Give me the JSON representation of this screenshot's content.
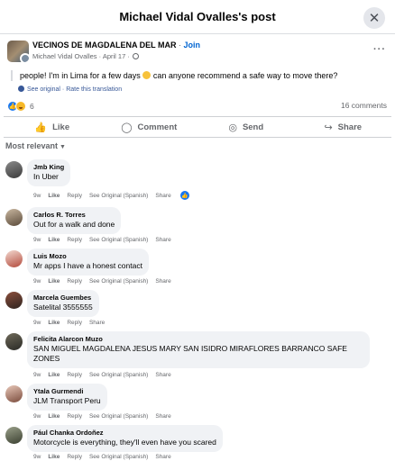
{
  "header": {
    "title": "Michael Vidal Ovalles's post",
    "close_icon": "close-icon"
  },
  "post": {
    "group_name": "VECINOS DE MAGDALENA DEL MAR",
    "separator": "·",
    "join_label": "Join",
    "author_meta": "Michael Vidal Ovalles · April 17 ·",
    "text_before_emoji": "people! I'm in Lima for a few days",
    "text_after_emoji": "can anyone recommend a safe way to move there?",
    "see_original": "See original",
    "rate_translation": "Rate this translation",
    "translate_separator": "·",
    "reaction_count": "6",
    "comments_count": "16 comments"
  },
  "actions": {
    "like": "Like",
    "comment": "Comment",
    "send": "Send",
    "share": "Share"
  },
  "sort_label": "Most relevant",
  "colors": {
    "accent": "#1877f2",
    "bubble": "#f0f2f5",
    "muted": "#65676b",
    "link": "#385898"
  },
  "comments": [
    {
      "name": "Jmb King",
      "text": "In Uber",
      "time": "9w",
      "like": "Like",
      "reply": "Reply",
      "see_original": "See Original (Spanish)",
      "share": "Share",
      "has_reaction": true
    },
    {
      "name": "Carlos R. Torres",
      "text": "Out for a walk and done",
      "time": "9w",
      "like": "Like",
      "reply": "Reply",
      "see_original": "See Original (Spanish)",
      "share": "Share"
    },
    {
      "name": "Luis Mozo",
      "text": "Mr apps I have a honest contact",
      "time": "9w",
      "like": "Like",
      "reply": "Reply",
      "see_original": "See Original (Spanish)",
      "share": "Share"
    },
    {
      "name": "Marcela Guembes",
      "text": "Satelital 3555555",
      "time": "9w",
      "like": "Like",
      "reply": "Reply",
      "share": "Share"
    },
    {
      "name": "Felicita Alarcon Muzo",
      "text": "SAN MIGUEL MAGDALENA JESUS MARY SAN ISIDRO MIRAFLORES BARRANCO SAFE ZONES",
      "time": "9w",
      "like": "Like",
      "reply": "Reply",
      "see_original": "See Original (Spanish)",
      "share": "Share"
    },
    {
      "name": "Ytala Gurmendi",
      "text": "JLM Transport Peru",
      "time": "9w",
      "like": "Like",
      "reply": "Reply",
      "see_original": "See Original (Spanish)",
      "share": "Share"
    },
    {
      "name": "Pául Chanka Ordoñez",
      "text": "Motorcycle is everything, they'll even have you scared",
      "time": "9w",
      "like": "Like",
      "reply": "Reply",
      "see_original": "See Original (Spanish)",
      "share": "Share"
    }
  ]
}
